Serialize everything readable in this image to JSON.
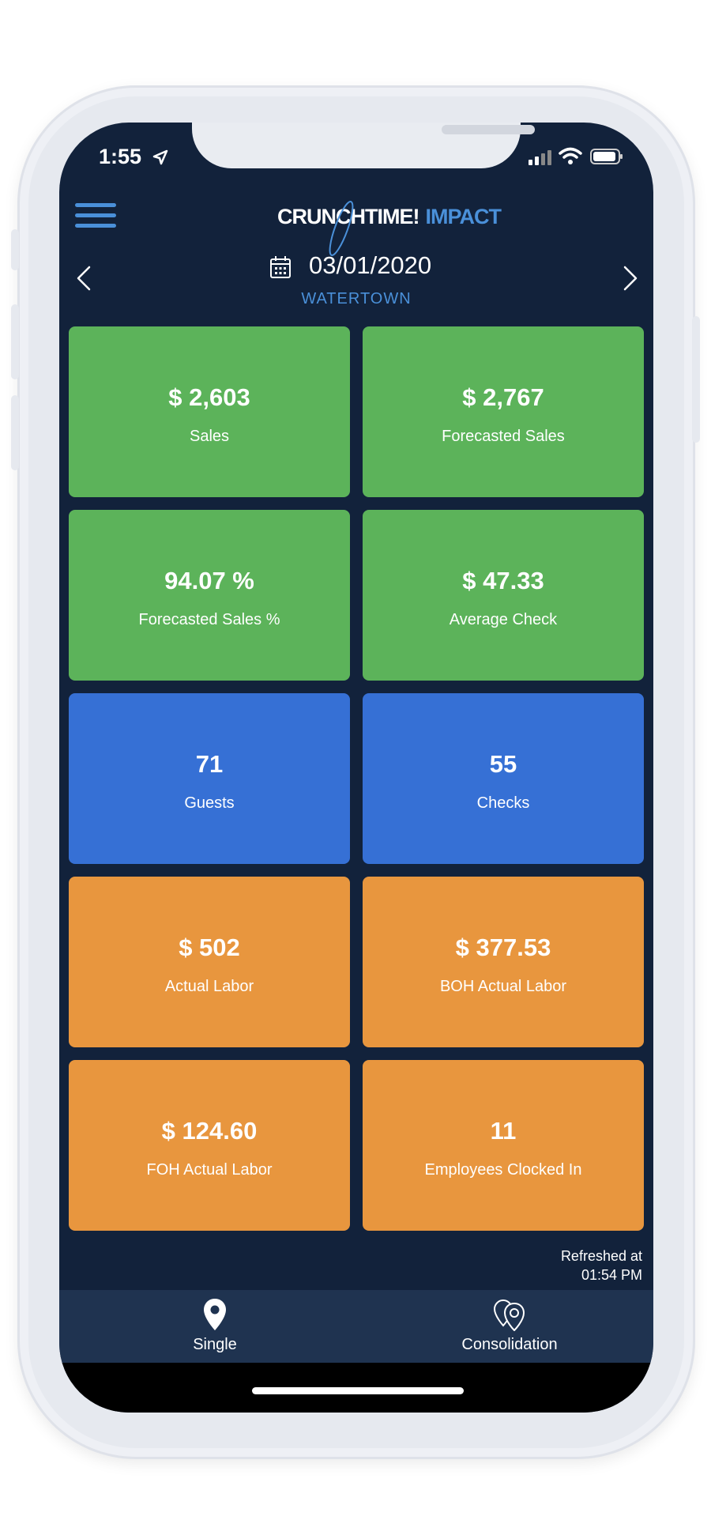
{
  "status_bar": {
    "time": "1:55"
  },
  "header": {
    "logo_primary": "CRUNCHTIME!",
    "logo_secondary": "IMPACT",
    "date": "03/01/2020",
    "location": "WATERTOWN"
  },
  "tiles": [
    {
      "value": "$ 2,603",
      "label": "Sales",
      "color": "#5cb35a"
    },
    {
      "value": "$ 2,767",
      "label": "Forecasted Sales",
      "color": "#5cb35a"
    },
    {
      "value": "94.07 %",
      "label": "Forecasted Sales %",
      "color": "#5cb35a"
    },
    {
      "value": "$ 47.33",
      "label": "Average Check",
      "color": "#5cb35a"
    },
    {
      "value": "71",
      "label": "Guests",
      "color": "#3670d5"
    },
    {
      "value": "55",
      "label": "Checks",
      "color": "#3670d5"
    },
    {
      "value": "$ 502",
      "label": "Actual Labor",
      "color": "#e8963e"
    },
    {
      "value": "$ 377.53",
      "label": "BOH Actual Labor",
      "color": "#e8963e"
    },
    {
      "value": "$ 124.60",
      "label": "FOH Actual Labor",
      "color": "#e8963e"
    },
    {
      "value": "11",
      "label": "Employees Clocked In",
      "color": "#e8963e"
    }
  ],
  "refresh": {
    "line1": "Refreshed at",
    "line2": "01:54 PM"
  },
  "tabbar": {
    "single_label": "Single",
    "consolidation_label": "Consolidation"
  },
  "colors": {
    "background": "#12223b",
    "accent": "#4a90d9",
    "tabbar": "#1f3350"
  }
}
